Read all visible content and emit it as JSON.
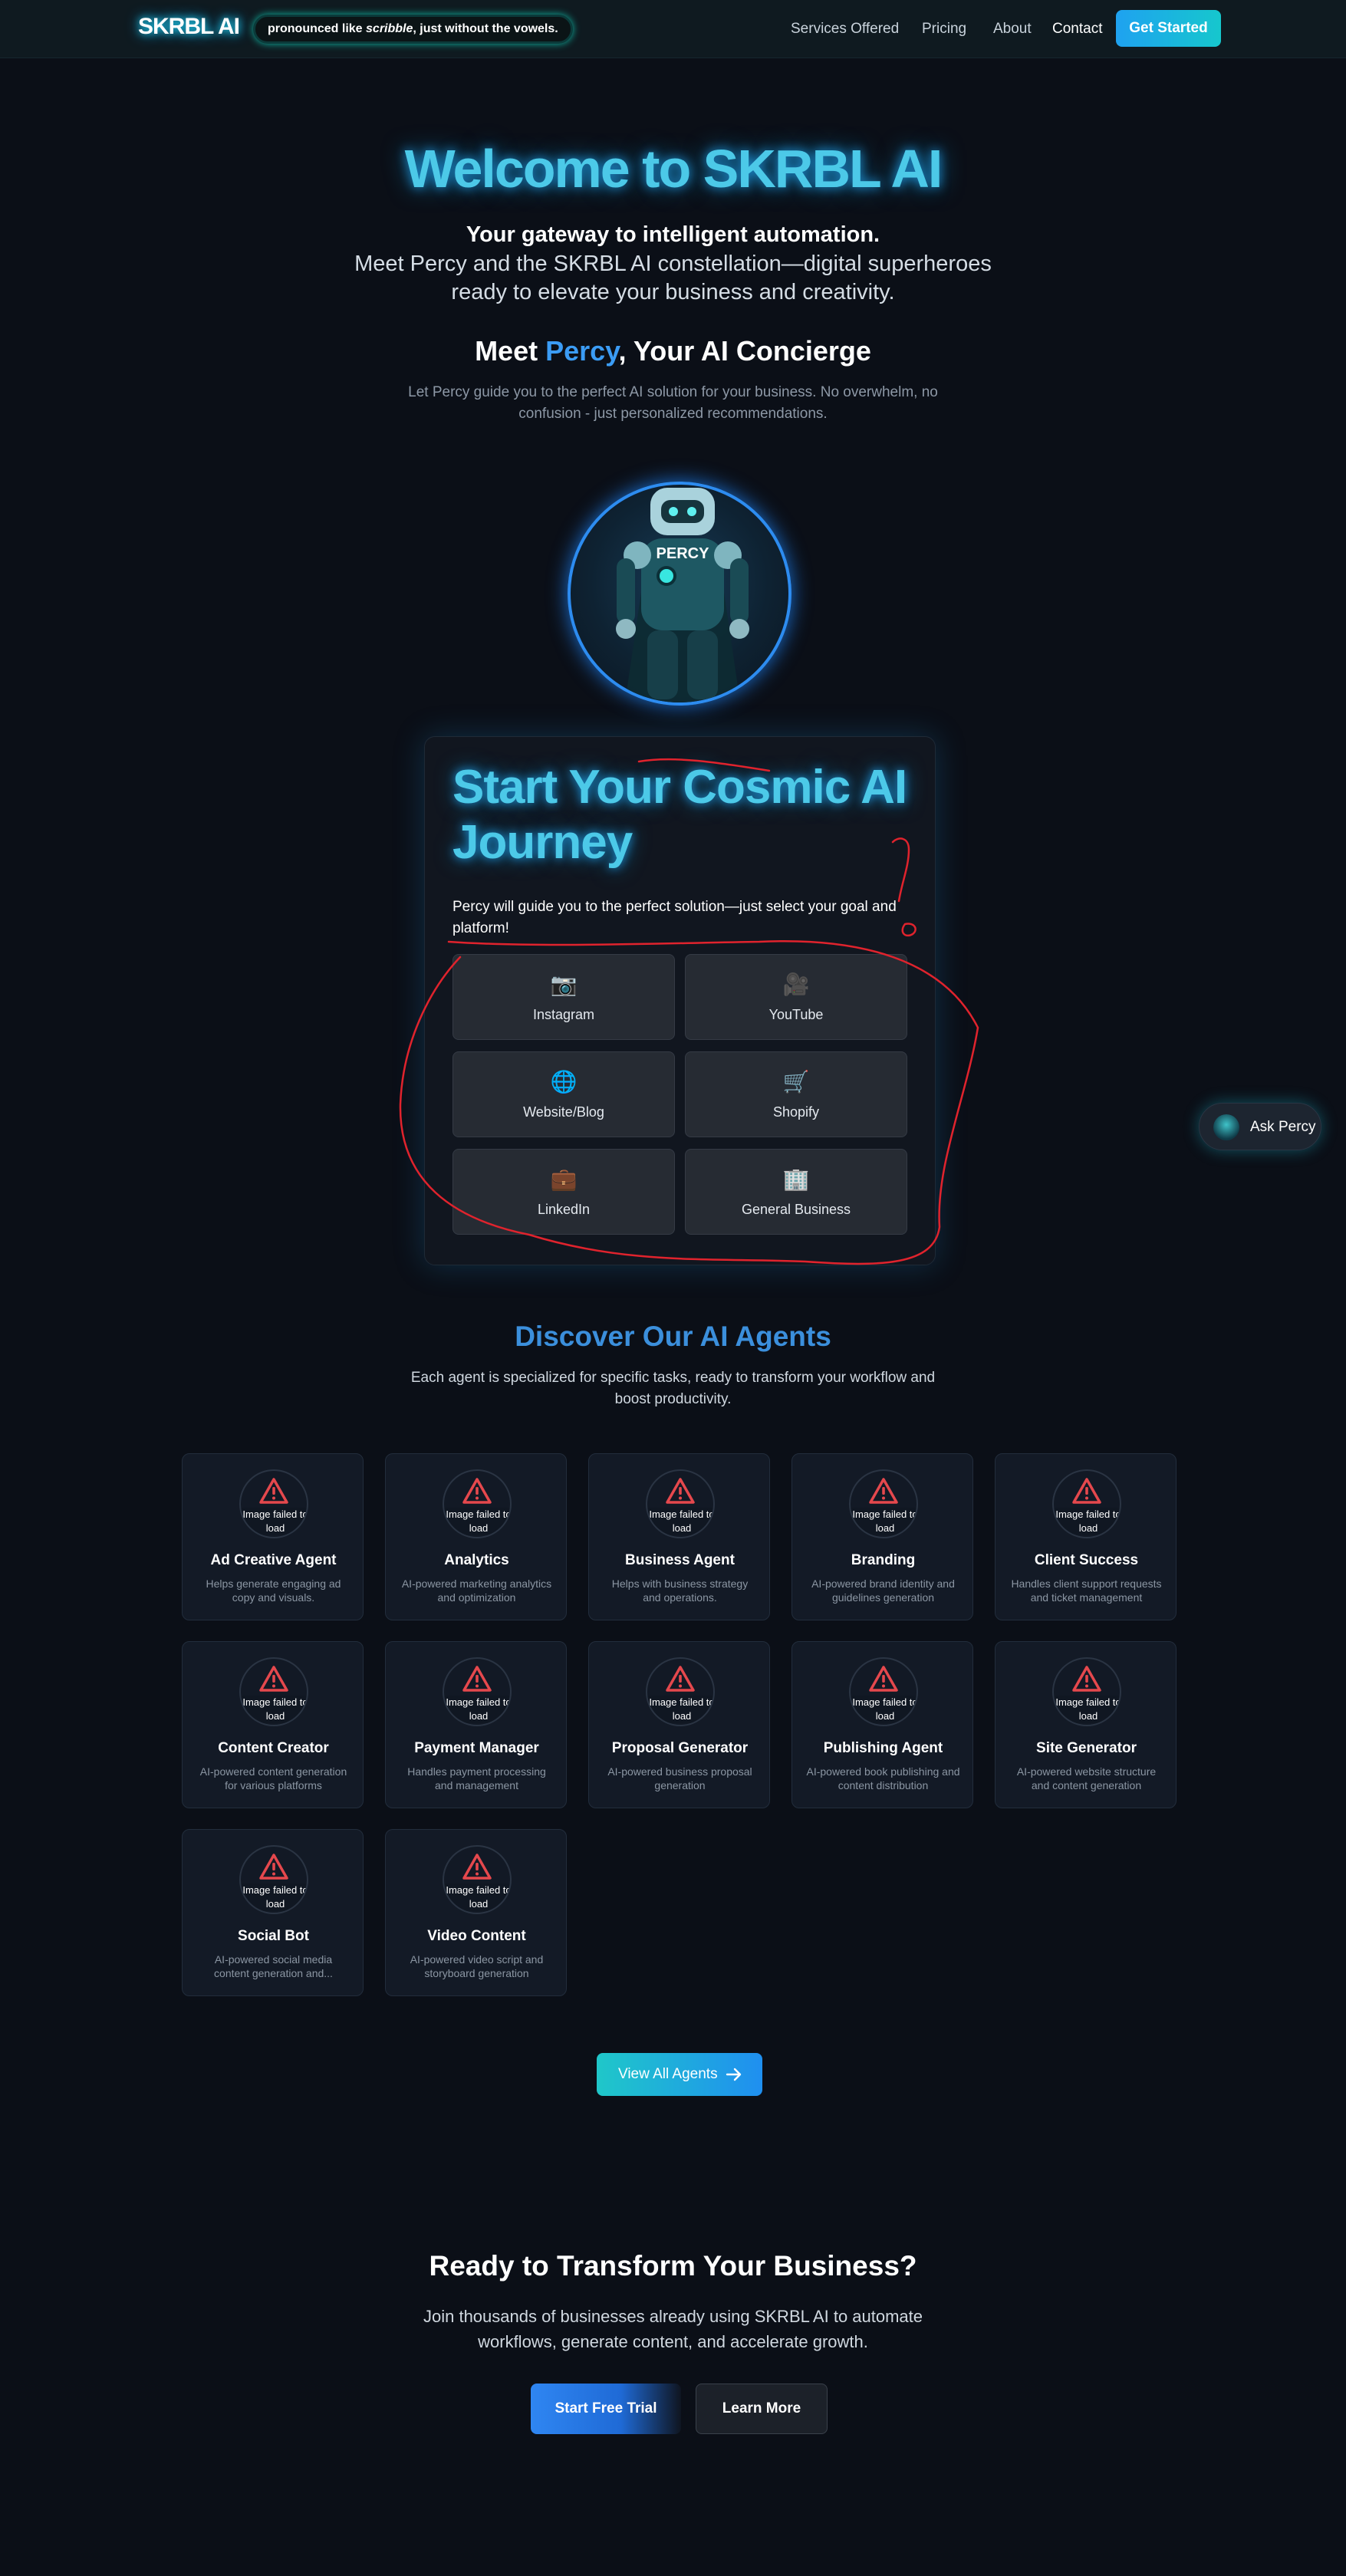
{
  "nav": {
    "logo": "SKRBL AI",
    "pronounce_prefix": "pronounced like ",
    "pronounce_word": "scribble",
    "pronounce_suffix": ", just without the vowels.",
    "links": [
      "Services Offered",
      "Pricing",
      "About",
      "Contact"
    ],
    "cta": "Get Started"
  },
  "hero": {
    "title": "Welcome to SKRBL AI",
    "tagline": "Your gateway to intelligent automation.",
    "description": "Meet Percy and the SKRBL AI constellation—digital superheroes ready to elevate your business and creativity."
  },
  "concierge": {
    "title_prefix": "Meet ",
    "title_accent": "Percy",
    "title_suffix": ", Your AI Concierge",
    "subtitle": "Let Percy guide you to the perfect AI solution for your business. No overwhelm, no confusion - just personalized recommendations.",
    "avatar_label": "PERCY"
  },
  "journey": {
    "title": "Start Your Cosmic AI Journey",
    "subtitle": "Percy will guide you to the perfect solution—just select your goal and platform!",
    "platforms": [
      {
        "label": "Instagram",
        "icon": "📷"
      },
      {
        "label": "YouTube",
        "icon": "🎥"
      },
      {
        "label": "Website/Blog",
        "icon": "🌐"
      },
      {
        "label": "Shopify",
        "icon": "🛒"
      },
      {
        "label": "LinkedIn",
        "icon": "💼"
      },
      {
        "label": "General Business",
        "icon": "🏢"
      }
    ]
  },
  "ask_percy": {
    "label": "Ask Percy"
  },
  "agents": {
    "title": "Discover Our AI Agents",
    "subtitle": "Each agent is specialized for specific tasks, ready to transform your workflow and boost productivity.",
    "image_fail_text": "Image failed to load",
    "items": [
      {
        "name": "Ad Creative Agent",
        "desc": "Helps generate engaging ad copy and visuals."
      },
      {
        "name": "Analytics",
        "desc": "AI-powered marketing analytics and optimization"
      },
      {
        "name": "Business Agent",
        "desc": "Helps with business strategy and operations."
      },
      {
        "name": "Branding",
        "desc": "AI-powered brand identity and guidelines generation"
      },
      {
        "name": "Client Success",
        "desc": "Handles client support requests and ticket management"
      },
      {
        "name": "Content Creator",
        "desc": "AI-powered content generation for various platforms"
      },
      {
        "name": "Payment Manager",
        "desc": "Handles payment processing and management"
      },
      {
        "name": "Proposal Generator",
        "desc": "AI-powered business proposal generation"
      },
      {
        "name": "Publishing Agent",
        "desc": "AI-powered book publishing and content distribution"
      },
      {
        "name": "Site Generator",
        "desc": "AI-powered website structure and content generation"
      },
      {
        "name": "Social Bot",
        "desc": "AI-powered social media content generation and..."
      },
      {
        "name": "Video Content",
        "desc": "AI-powered video script and storyboard generation"
      }
    ],
    "view_all": "View All Agents"
  },
  "cta": {
    "title": "Ready to Transform Your Business?",
    "subtitle": "Join thousands of businesses already using SKRBL AI to automate workflows, generate content, and accelerate growth.",
    "primary": "Start Free Trial",
    "secondary": "Learn More"
  },
  "colors": {
    "background": "#0b0f17",
    "accent_cyan": "#4cc9e8",
    "accent_blue": "#3b9cf5",
    "warning_red": "#e5484d",
    "annotation_red": "#e0232d"
  }
}
